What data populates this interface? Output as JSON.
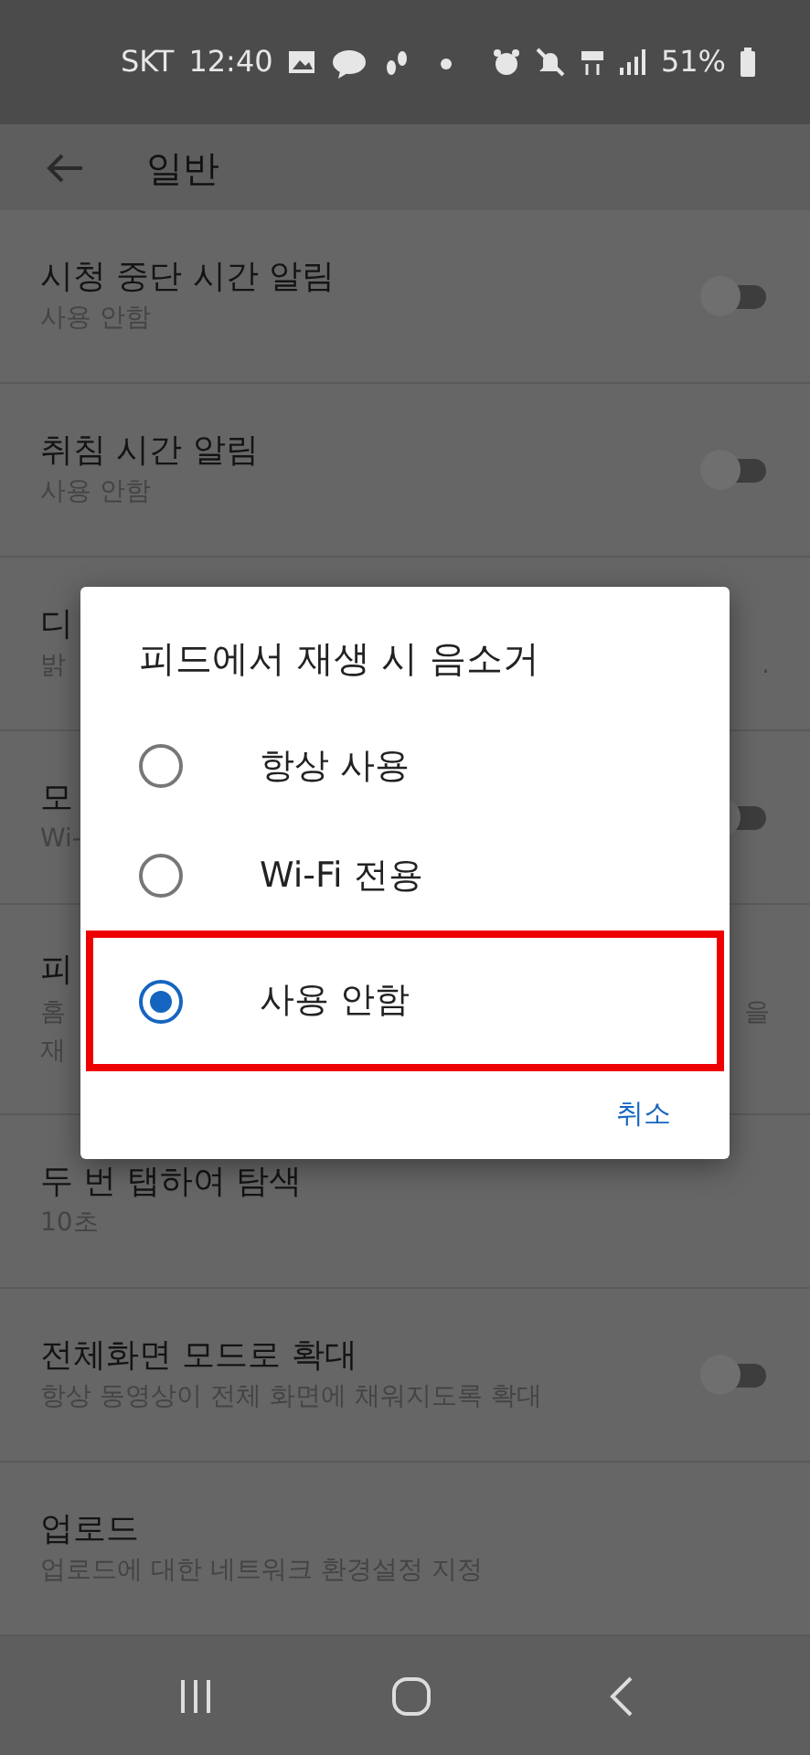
{
  "status_bar": {
    "carrier": "SKT",
    "time": "12:40",
    "battery": "51%"
  },
  "app_bar": {
    "title": "일반"
  },
  "rows": [
    {
      "kind": "switch",
      "title": "시청 중단 시간 알림",
      "subtitle": "사용 안함",
      "on": false
    },
    {
      "kind": "switch",
      "title": "취침 시간 알림",
      "subtitle": "사용 안함",
      "on": false
    },
    {
      "kind": "covered",
      "title": "디",
      "lines": [
        {
          "start": "밝",
          "end": "."
        }
      ]
    },
    {
      "kind": "covered-switch",
      "title": "모",
      "lines": [
        {
          "start": "Wi-"
        }
      ],
      "on": false
    },
    {
      "kind": "covered",
      "title": "피",
      "lines": [
        {
          "start": "홈",
          "end": "을"
        },
        {
          "start": "재"
        }
      ]
    },
    {
      "kind": "plain",
      "title": "두 번 탭하여 탐색",
      "subtitle": "10초"
    },
    {
      "kind": "switch",
      "title": "전체화면 모드로 확대",
      "subtitle": "항상 동영상이 전체 화면에 채워지도록 확대",
      "on": false
    },
    {
      "kind": "plain",
      "title": "업로드",
      "subtitle": "업로드에 대한 네트워크 환경설정 지정"
    }
  ],
  "dialog": {
    "title": "피드에서 재생 시 음소거",
    "options": [
      {
        "label": "항상 사용",
        "selected": false,
        "highlighted": false
      },
      {
        "label": "Wi-Fi 전용",
        "selected": false,
        "highlighted": false
      },
      {
        "label": "사용 안함",
        "selected": true,
        "highlighted": true
      }
    ],
    "cancel": "취소"
  }
}
